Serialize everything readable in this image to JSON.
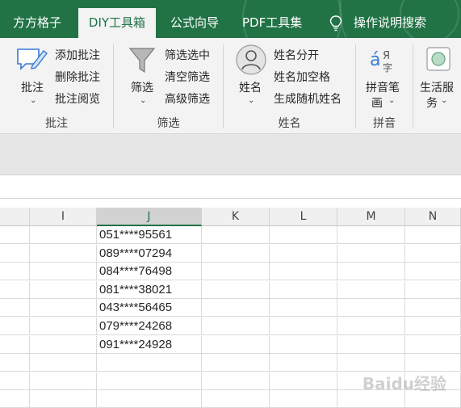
{
  "tabs": [
    "方方格子",
    "DIY工具箱",
    "公式向导",
    "PDF工具集",
    "操作说明搜索"
  ],
  "active_tab_index": 1,
  "ribbon": {
    "comment_group": {
      "big_label": "批注",
      "items": [
        "添加批注",
        "删除批注",
        "批注阅览"
      ],
      "group_label": "批注"
    },
    "filter_group": {
      "big_label": "筛选",
      "items": [
        "筛选选中",
        "清空筛选",
        "高级筛选"
      ],
      "group_label": "筛选"
    },
    "name_group": {
      "big_label": "姓名",
      "items": [
        "姓名分开",
        "姓名加空格",
        "生成随机姓名"
      ],
      "group_label": "姓名"
    },
    "pinyin_group": {
      "big_label_line1": "拼音笔",
      "big_label_line2": "画",
      "group_label": "拼音"
    },
    "life_group": {
      "big_label_line1": "生活服",
      "big_label_line2": "务"
    }
  },
  "columns": [
    "I",
    "J",
    "K",
    "L",
    "M",
    "N"
  ],
  "selected_column": "J",
  "cells_J": [
    "051****95561",
    "089****07294",
    "084****76498",
    "081****38021",
    "043****56465",
    "079****24268",
    "091****24928"
  ],
  "watermark": "Baidu经验",
  "colors": {
    "accent": "#217346",
    "ribbon_bg": "#f3f3f3"
  }
}
